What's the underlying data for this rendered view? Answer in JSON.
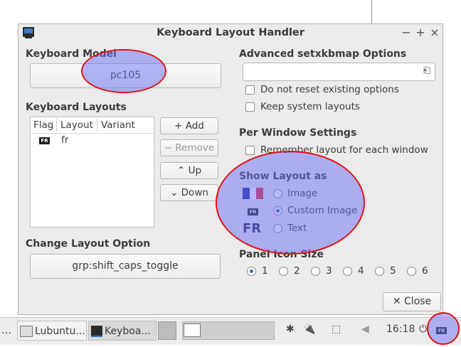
{
  "window": {
    "title": "Keyboard Layout Handler",
    "controls": {
      "minimize": "−",
      "maximize": "+",
      "close": "×"
    }
  },
  "left": {
    "keyboard_model": {
      "heading": "Keyboard Model",
      "value": "pc105"
    },
    "keyboard_layouts": {
      "heading": "Keyboard Layouts",
      "columns": [
        "Flag",
        "Layout",
        "Variant"
      ],
      "rows": [
        {
          "flag": "FR",
          "layout": "fr",
          "variant": ""
        }
      ],
      "buttons": {
        "add": "+ Add",
        "remove": "− Remove",
        "up": "⌃ Up",
        "down": "⌄ Down"
      }
    },
    "change_layout_option": {
      "heading": "Change Layout Option",
      "value": "grp:shift_caps_toggle"
    }
  },
  "right": {
    "advanced": {
      "heading": "Advanced setxkbmap Options",
      "value": "",
      "checkboxes": [
        {
          "label": "Do not reset existing options",
          "checked": false
        },
        {
          "label": "Keep system layouts",
          "checked": false
        }
      ]
    },
    "per_window": {
      "heading": "Per Window Settings",
      "checkbox": {
        "label": "Remember layout for each window",
        "checked": false
      }
    },
    "show_layout_as": {
      "heading": "Show Layout as",
      "options": [
        {
          "label": "Image",
          "selected": false
        },
        {
          "label": "Custom Image",
          "selected": true
        },
        {
          "label": "Text",
          "selected": false
        }
      ],
      "flag_badge": "FR",
      "text_preview": "FR"
    },
    "panel_icon_size": {
      "heading": "Panel Icon Size",
      "options": [
        "1",
        "2",
        "3",
        "4",
        "5",
        "6"
      ],
      "selected": "1"
    }
  },
  "close_button": "✕ Close",
  "taskbar": {
    "tasks": [
      {
        "label": "Lubuntu..."
      },
      {
        "label": "Keyboa..."
      }
    ],
    "clock": "16:18",
    "tray_badge": "FR"
  },
  "colors": {
    "accent": "#3d6cb6",
    "annotation_stroke": "#e01414",
    "annotation_fill": "#6e6ef5"
  }
}
